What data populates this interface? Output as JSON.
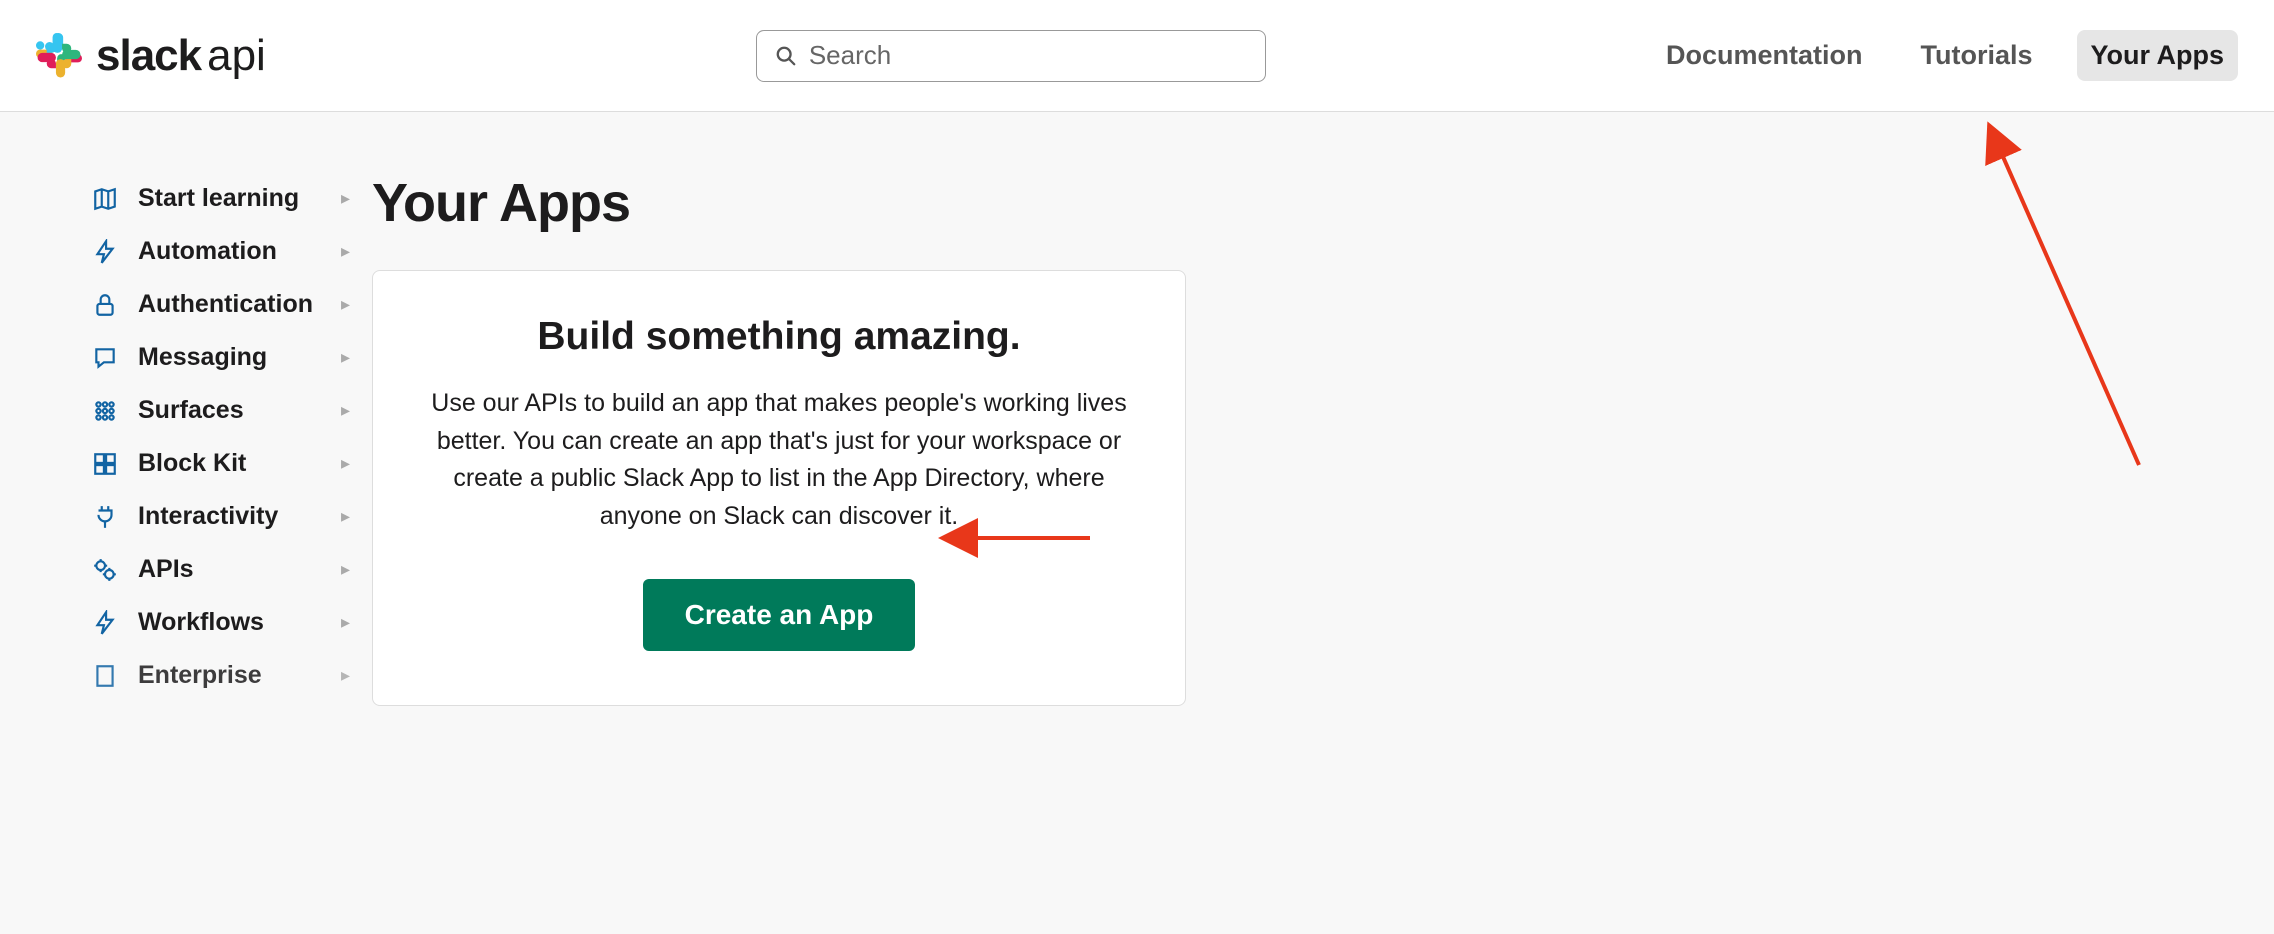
{
  "header": {
    "logo_bold": "slack",
    "logo_light": "api",
    "search_placeholder": "Search",
    "nav": {
      "documentation": "Documentation",
      "tutorials": "Tutorials",
      "your_apps": "Your Apps"
    }
  },
  "sidebar": {
    "items": [
      {
        "label": "Start learning",
        "icon": "map"
      },
      {
        "label": "Automation",
        "icon": "bolt"
      },
      {
        "label": "Authentication",
        "icon": "lock"
      },
      {
        "label": "Messaging",
        "icon": "chat"
      },
      {
        "label": "Surfaces",
        "icon": "grid"
      },
      {
        "label": "Block Kit",
        "icon": "blocks"
      },
      {
        "label": "Interactivity",
        "icon": "plug"
      },
      {
        "label": "APIs",
        "icon": "gears"
      },
      {
        "label": "Workflows",
        "icon": "bolt"
      },
      {
        "label": "Enterprise",
        "icon": "building"
      }
    ]
  },
  "main": {
    "title": "Your Apps",
    "card": {
      "heading": "Build something amazing.",
      "description": "Use our APIs to build an app that makes people's working lives better. You can create an app that's just for your workspace or create a public Slack App to list in the App Directory, where anyone on Slack can discover it.",
      "button_label": "Create an App"
    }
  }
}
